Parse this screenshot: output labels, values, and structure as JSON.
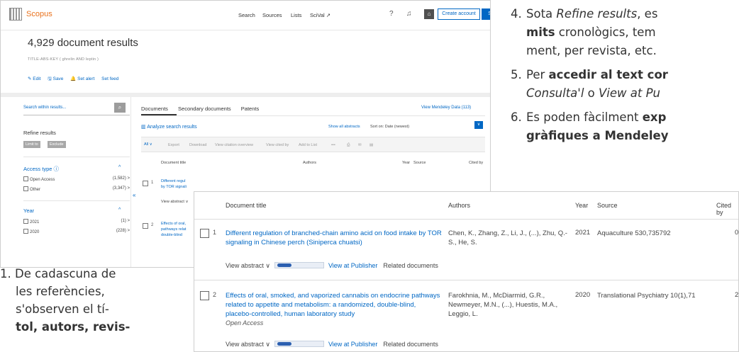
{
  "scopus": {
    "brand": "Scopus",
    "nav": [
      "Search",
      "Sources",
      "Lists",
      "SciVal ↗"
    ],
    "create_account": "Create account",
    "sign_in": "Sign in",
    "results_title": "4,929 document results",
    "query": "TITLE-ABS-KEY ( ghrelin  AND  leptin )",
    "actions": [
      "✎ Edit",
      "🖫 Save",
      "🔔 Set alert",
      "Set feed"
    ],
    "search_within_placeholder": "Search within results...",
    "refine_results": "Refine results",
    "limit_to": "Limit to",
    "exclude": "Exclude",
    "access_type": "Access type ⓘ",
    "access_rows": [
      {
        "label": "Open Access",
        "count": "(1,582) >"
      },
      {
        "label": "Other",
        "count": "(3,347) >"
      }
    ],
    "year_header": "Year",
    "year_rows": [
      {
        "label": "2021",
        "count": "(1) >"
      },
      {
        "label": "2020",
        "count": "(228) >"
      }
    ],
    "tabs": [
      "Documents",
      "Secondary documents",
      "Patents"
    ],
    "mendeley": "View Mendeley Data (113)",
    "analyze": "Analyze search results",
    "show_all_abstracts": "Show all abstracts",
    "sort_on": "Sort on: Date (newest)",
    "toolbar": [
      "All ∨",
      "Export",
      "Download",
      "View citation overview",
      "View cited by",
      "Add to List",
      "•••",
      "⎙",
      "✉",
      "▤"
    ],
    "col_document_title": "Document title",
    "col_authors": "Authors",
    "col_year": "Year",
    "col_source": "Source",
    "col_cited": "Cited by",
    "row1_num": "1",
    "row1_title_a": "Different regul",
    "row1_title_b": "by TOR signali",
    "row1_view": "View abstract ∨",
    "row2_num": "2",
    "row2_title_a": "Effects of oral,",
    "row2_title_b": "pathways relat",
    "row2_title_c": "double-blind"
  },
  "steps": {
    "s4_num": "4.",
    "s4_l1_a": "Sota ",
    "s4_l1_i": "Refine results",
    "s4_l1_b": ", es",
    "s4_l2_b": "mits",
    "s4_l2_c": " cronològics, tem",
    "s4_l3": "ment, per revista, etc.",
    "s5_num": "5.",
    "s5_l1_a": "Per ",
    "s5_l1_b": "accedir al text cor",
    "s5_l2_i1": "Consulta'l",
    "s5_l2_o": " o ",
    "s5_l2_i2": "View at Pu",
    "s6_num": "6.",
    "s6_l1_a": "Es poden fàcilment ",
    "s6_l1_b": "exp",
    "s6_l2_b": "gràfiques a Mendeley"
  },
  "side": {
    "l1": "1. De cadascuna de",
    "l2": "les  referències,",
    "l3": "s'observen el tí-",
    "l4": "tol, autors, revis-"
  },
  "zoom": {
    "col_document_title": "Document title",
    "col_authors": "Authors",
    "col_year": "Year",
    "col_source": "Source",
    "col_cited": "Cited by",
    "rows": [
      {
        "num": "1",
        "title": "Different regulation of branched-chain amino acid on food intake by TOR signaling in Chinese perch (Siniperca chuatsi)",
        "authors": "Chen, K., Zhang, Z., Li, J., (...), Zhu, Q.-S., He, S.",
        "year": "2021",
        "source": "Aquaculture 530,735792",
        "cited": "0",
        "oa": ""
      },
      {
        "num": "2",
        "title": "Effects of oral, smoked, and vaporized cannabis on endocrine pathways related to appetite and metabolism: a randomized, double-blind, placebo-controlled, human laboratory study",
        "authors": "Farokhnia, M., McDiarmid, G.R., Newmeyer, M.N., (...), Huestis, M.A., Leggio, L.",
        "year": "2020",
        "source": "Translational Psychiatry 10(1),71",
        "cited": "2",
        "oa": "Open Access"
      }
    ],
    "view_abstract": "View abstract ∨",
    "view_at_publisher": "View at Publisher",
    "related_documents": "Related documents"
  }
}
